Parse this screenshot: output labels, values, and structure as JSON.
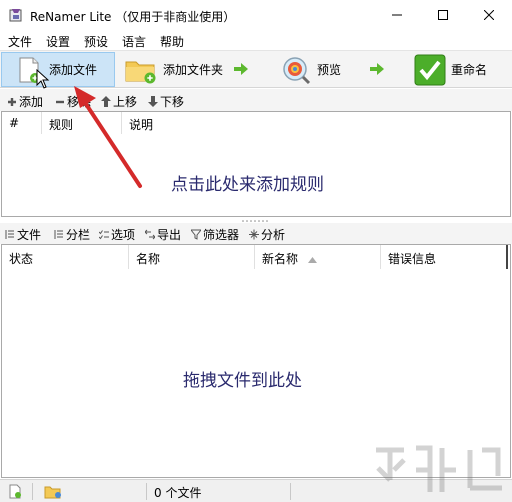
{
  "window": {
    "title": "ReNamer Lite （仅用于非商业使用）"
  },
  "menu": [
    "文件",
    "设置",
    "预设",
    "语言",
    "帮助"
  ],
  "toolbar": {
    "add_files": "添加文件",
    "add_folder": "添加文件夹",
    "preview": "预览",
    "rename": "重命名"
  },
  "rules_toolbar": {
    "add": "添加",
    "remove": "移除",
    "move_up": "上移",
    "move_down": "下移"
  },
  "rules_table": {
    "columns": [
      "#",
      "规则",
      "说明"
    ],
    "empty_hint": "点击此处来添加规则"
  },
  "files_toolbar": {
    "files": "文件",
    "columns": "分栏",
    "options": "选项",
    "export": "导出",
    "filter": "筛选器",
    "analyze": "分析"
  },
  "files_table": {
    "columns": [
      "状态",
      "名称",
      "新名称",
      "错误信息"
    ],
    "empty_hint": "拖拽文件到此处"
  },
  "status": {
    "file_count": "0 个文件"
  },
  "colors": {
    "accent_arrow": "#5cb82e",
    "annotation": "#d42a2a",
    "hint_text": "#2a2a6e"
  }
}
